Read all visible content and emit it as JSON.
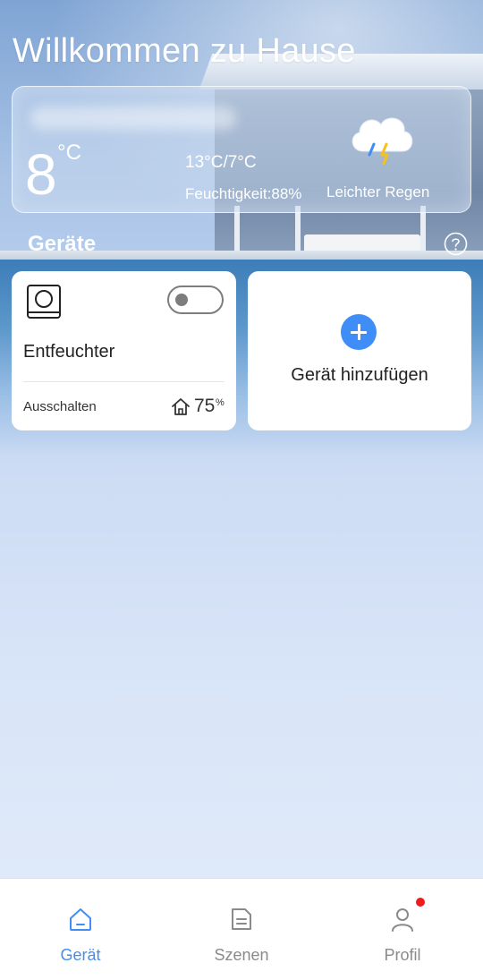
{
  "header": {
    "title": "Willkommen zu Hause"
  },
  "weather": {
    "temperature": "8",
    "unit": "°C",
    "range": "13°C/7°C",
    "humidity": "Feuchtigkeit:88%",
    "condition": "Leichter Regen",
    "icon": "cloud-lightning-rain-icon"
  },
  "devices_section": {
    "title": "Geräte",
    "help_icon": "question-circle-icon"
  },
  "devices": [
    {
      "name": "Entfeuchter",
      "status": "Ausschalten",
      "humidity_value": "75",
      "humidity_unit": "%",
      "power_on": false,
      "icon": "dehumidifier-icon"
    }
  ],
  "add_device": {
    "label": "Gerät hinzufügen",
    "icon": "plus-circle-icon"
  },
  "tabs": [
    {
      "label": "Gerät",
      "icon": "home-icon",
      "active": true
    },
    {
      "label": "Szenen",
      "icon": "document-icon",
      "active": false
    },
    {
      "label": "Profil",
      "icon": "person-icon",
      "active": false,
      "badge": true
    }
  ],
  "colors": {
    "accent": "#3f8ef7",
    "badge": "#ee1c1c"
  }
}
